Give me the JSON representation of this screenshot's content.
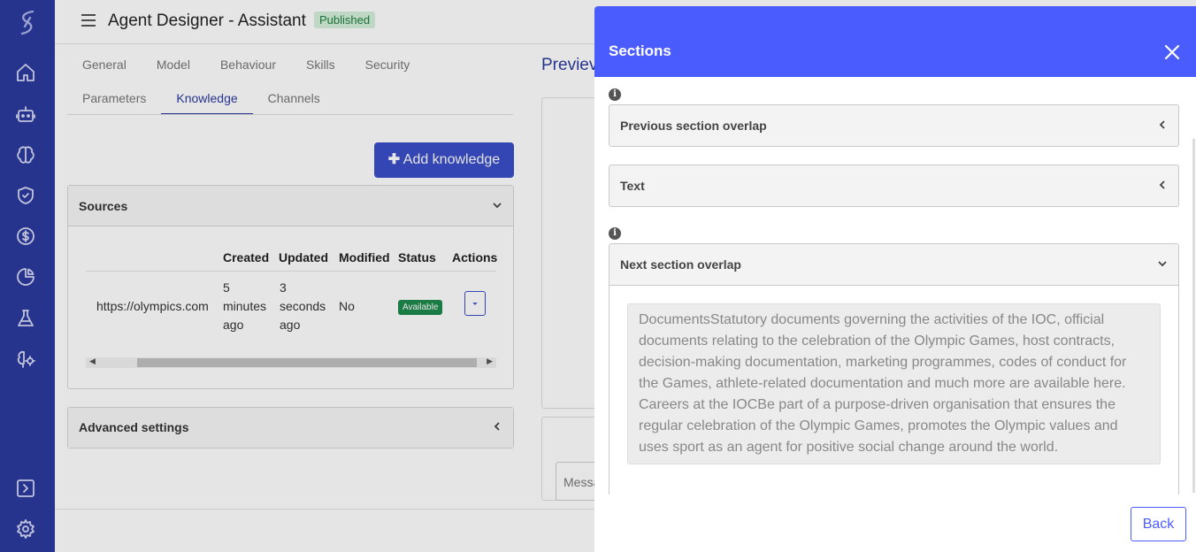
{
  "sidebar": {
    "icons": [
      "logo-icon",
      "home-icon",
      "bot-icon",
      "brain-icon",
      "shield-icon",
      "dollar-icon",
      "pie-chart-icon",
      "flask-icon",
      "brain-gear-icon",
      "expand-icon",
      "gear-icon"
    ]
  },
  "header": {
    "title": "Agent Designer - Assistant",
    "status_badge": "Published"
  },
  "tabs_row1": [
    "General",
    "Model",
    "Behaviour",
    "Skills",
    "Security"
  ],
  "tabs_row2": [
    "Parameters",
    "Knowledge",
    "Channels"
  ],
  "active_tab": "Knowledge",
  "add_knowledge_label": "Add knowledge",
  "sources": {
    "title": "Sources",
    "columns": [
      "Created",
      "Updated",
      "Modified",
      "Status",
      "Actions"
    ],
    "row": {
      "url": "https://olympics.com",
      "created": [
        "5",
        "minutes",
        "ago"
      ],
      "updated": [
        "3",
        "seconds",
        "ago"
      ],
      "modified": "No",
      "status": "Available"
    }
  },
  "advanced_settings": {
    "title": "Advanced settings"
  },
  "preview": {
    "title": "Previev",
    "message_placeholder": "Messa"
  },
  "modal": {
    "title": "Sections",
    "sections": [
      {
        "title": "Previous section overlap",
        "expanded": false
      },
      {
        "title": "Text",
        "expanded": false
      },
      {
        "title": "Next section overlap",
        "expanded": true,
        "content": "DocumentsStatutory documents governing the activities of the IOC, official documents relating to the celebration of the Olympic Games, host contracts, decision-making documentation, marketing programmes, codes of conduct for the Games, athlete-related documentation and much more are available here. Careers at the IOCBe part of a purpose-driven organisation that ensures the regular celebration of the Olympic Games, promotes the Olympic values and uses sport as an agent for positive social change around the world."
      }
    ],
    "back_label": "Back"
  },
  "colors": {
    "sidebar": "#2b3a9e",
    "modal_header": "#4b5cff",
    "published_badge_bg": "#d4f1dc",
    "available_badge": "#1f8a4c"
  }
}
